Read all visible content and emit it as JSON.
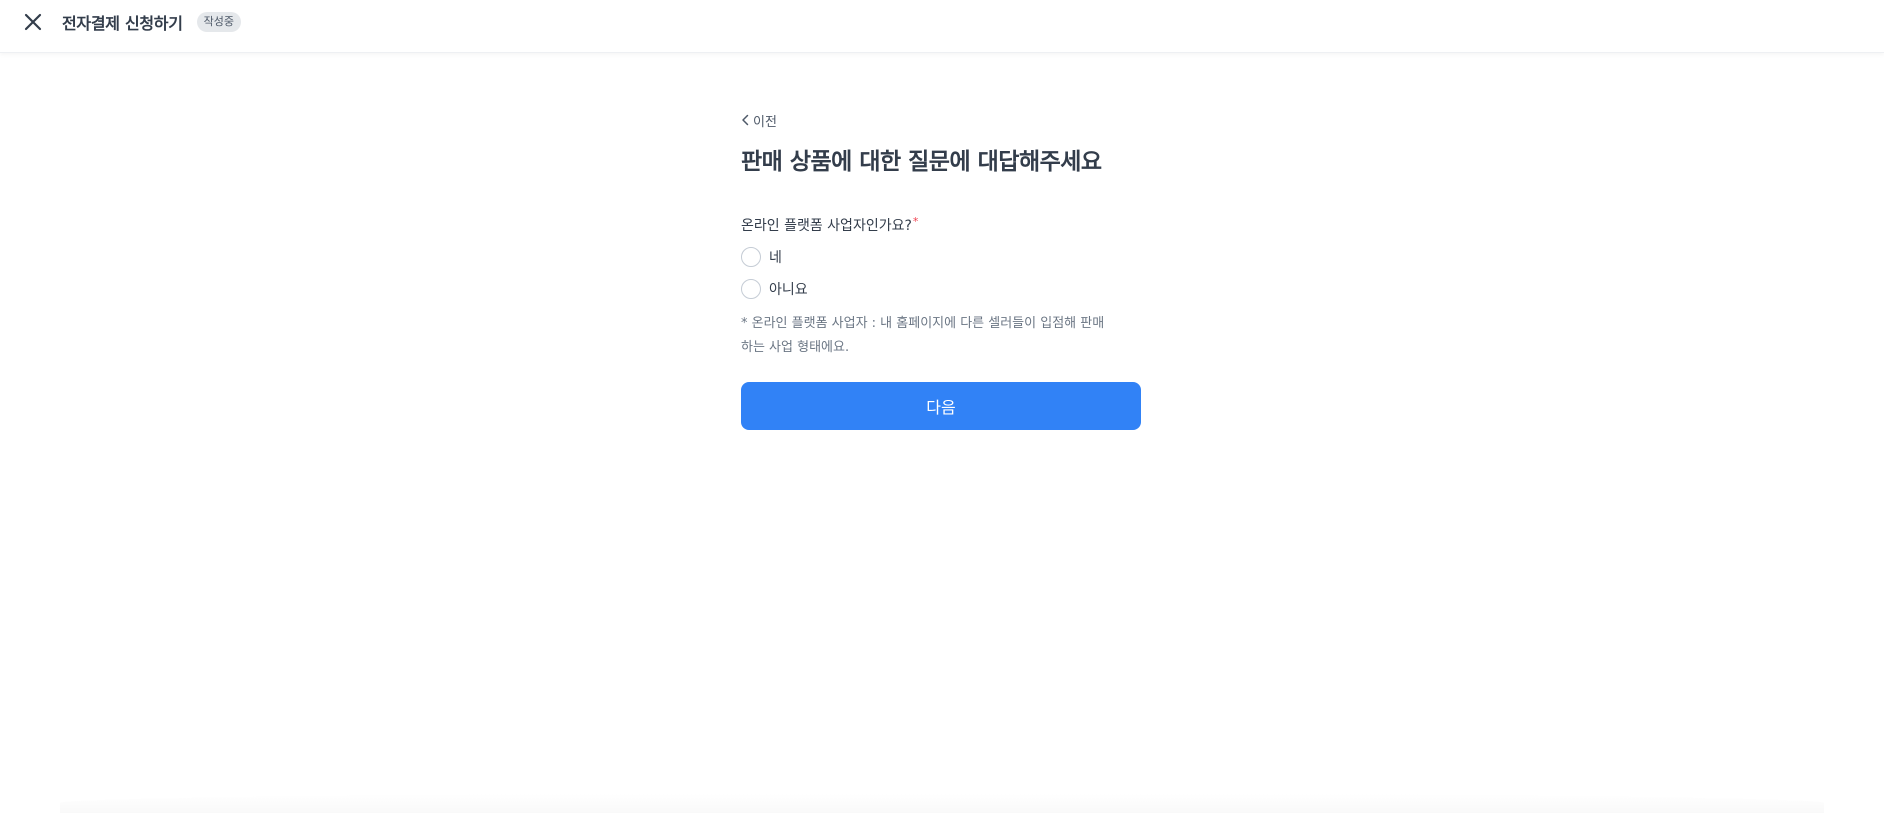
{
  "header": {
    "close_icon": "close-icon",
    "title": "전자결제 신청하기",
    "status_badge": "작성중"
  },
  "main": {
    "back_label": "이전",
    "back_icon": "chevron-left-icon",
    "title": "판매 상품에 대한 질문에 대답해주세요",
    "question": {
      "label": "온라인 플랫폼 사업자인가요?",
      "required_mark": "*",
      "options": [
        {
          "label": "네",
          "selected": false
        },
        {
          "label": "아니요",
          "selected": false
        }
      ]
    },
    "note": "* 온라인 플랫폼 사업자 : 내 홈페이지에 다른 셀러들이 입점해 판매하는 사업 형태에요.",
    "next_button": "다음"
  },
  "colors": {
    "primary": "#3182f6",
    "required": "#f04452",
    "text": "#333d4b",
    "muted": "#6b7684",
    "badge_bg": "#e5e8eb"
  }
}
